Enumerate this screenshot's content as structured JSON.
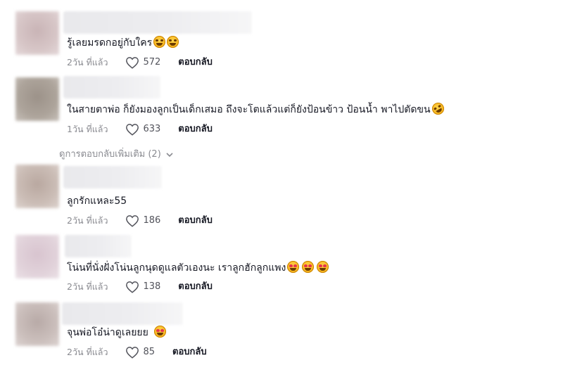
{
  "comments": [
    {
      "text": "รู้เลยมรดกอยู่กับใคร",
      "emojis": [
        "grinning-sweat-emoji",
        "grinning-sweat-emoji"
      ],
      "time": "2วัน ที่แล้ว",
      "likes": "572",
      "reply_label": "ตอบกลับ",
      "avatar_color": "#c9b4b6"
    },
    {
      "text": "ในสายตาพ่อ ก็ยังมองลูกเป็นเด็กเสมอ ถึงจะโตแล้วแต่ก็ยังป้อนข้าว ป้อนน้ำ พาไปตัดขน",
      "emojis": [
        "rolling-laughing-emoji"
      ],
      "time": "1วัน ที่แล้ว",
      "likes": "633",
      "reply_label": "ตอบกลับ",
      "avatar_color": "#9c9289"
    },
    {
      "text": "ลูกรักแหละ55",
      "emojis": [],
      "time": "2วัน ที่แล้ว",
      "likes": "186",
      "reply_label": "ตอบกลับ",
      "avatar_color": "#b9a8a0"
    },
    {
      "text": "โน่นที่นั่งฝั่งโน่นลูกนุดดูแลตัวเองนะ เราลูกฮักลูกแพง",
      "emojis": [
        "heart-eyes-emoji",
        "heart-eyes-emoji",
        "heart-eyes-emoji"
      ],
      "time": "2วัน ที่แล้ว",
      "likes": "138",
      "reply_label": "ตอบกลับ",
      "avatar_color": "#d8c4cf"
    },
    {
      "text": "จุนพ่อโอ๋น่าดูเลยยย",
      "emojis": [
        "heart-eyes-emoji"
      ],
      "time": "2วัน ที่แล้ว",
      "likes": "85",
      "reply_label": "ตอบกลับ",
      "avatar_color": "#b8aaa7"
    }
  ],
  "view_more_replies": "ดูการตอบกลับเพิ่มเติม (2)",
  "colors": {
    "text": "#161823",
    "muted": "#8a8b91",
    "like_count": "#52535b"
  }
}
